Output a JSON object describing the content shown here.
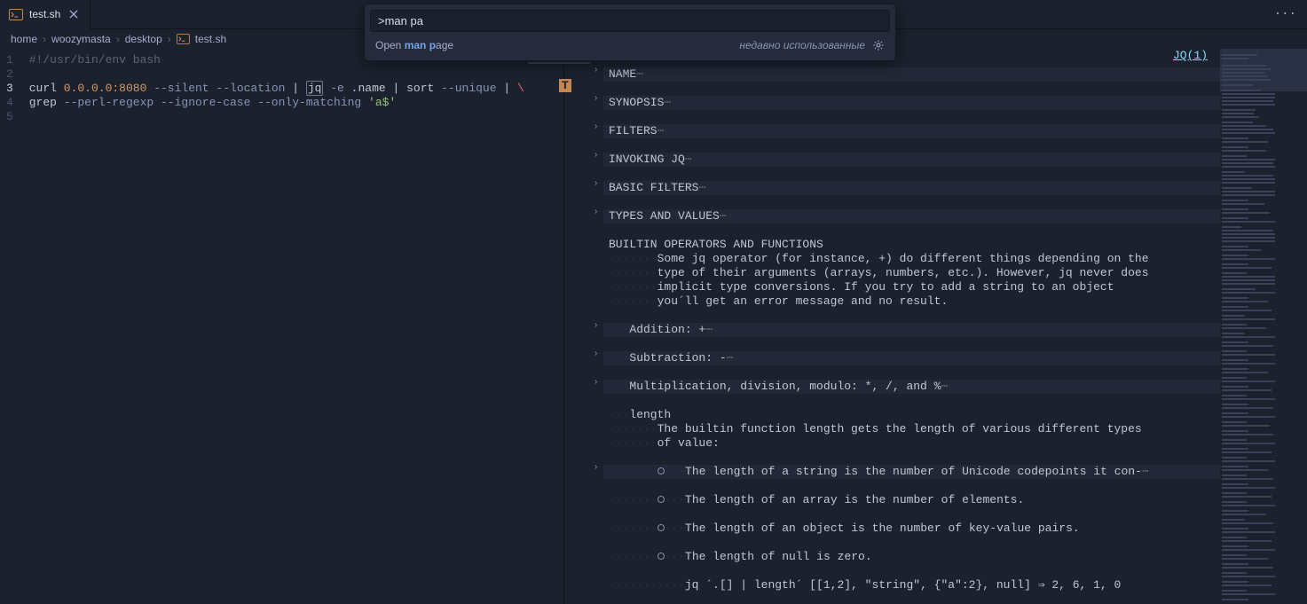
{
  "tab": {
    "icon": ">_",
    "name": "test.sh"
  },
  "breadcrumb": {
    "home": "home",
    "user": "woozymasta",
    "desktop": "desktop",
    "file": "test.sh"
  },
  "palette": {
    "input": ">man pa",
    "open_prefix": "Open ",
    "open_hl_man_p": "man p",
    "open_suffix": "age",
    "recent": "недавно использованные"
  },
  "left": {
    "l1": "#!/usr/bin/env bash",
    "l3_curl": "curl ",
    "l3_addr": "0.0.0.0:8080",
    "l3_silent": " --silent",
    "l3_location": " --location",
    "l3_pipe": " | ",
    "l3_jq": "jq",
    "l3_e": " -e ",
    "l3_name": ".name",
    "l3_pipe2": " | ",
    "l3_sort": "sort ",
    "l3_unique": "--unique",
    "l3_pipe3": " | ",
    "l3_bs": "\\",
    "l4_grep": "grep ",
    "l4_perl": "--perl-regexp",
    "l4_ic": " --ignore-case",
    "l4_om": " --only-matching",
    "l4_str": " 'a$'"
  },
  "right": {
    "jq_title": "JQ(1)",
    "s_name": "NAME",
    "s_syn": "SYNOPSIS",
    "s_filt": "FILTERS",
    "s_inv": "INVOKING JQ",
    "s_basic": "BASIC FILTERS",
    "s_types": "TYPES AND VALUES",
    "builtin_hdr": "BUILTIN OPERATORS AND FUNCTIONS",
    "btxt1": "Some jq operator (for instance, +) do different things depending on the",
    "btxt2": "type of their arguments (arrays, numbers, etc.). However, jq never does",
    "btxt3": "implicit type conversions. If you try to add  a  string  to  an  object",
    "btxt4": "you´ll get an error message and no result.",
    "addition": "Addition: +",
    "subtraction": "Subtraction: -",
    "muldiv": "Multiplication, division, modulo: *, /, and %",
    "length": "length",
    "len1": "The  builtin function length gets the length of various different types",
    "len2": "of value:",
    "li1": "The length of a string is the number of Unicode codepoints it  con-",
    "li2": "The length of an array is the number of elements.",
    "li3": "The length of an object is the number of key-value pairs.",
    "li4": "The length of null is zero.",
    "ex": "jq ´.[] | length´ [[1,2], \"string\", {\"a\":2}, null] ⇒ 2, 6, 1, 0"
  },
  "lines": {
    "l1": "1",
    "l2": "2",
    "l3": "3",
    "l4": "4",
    "l5": "5"
  }
}
